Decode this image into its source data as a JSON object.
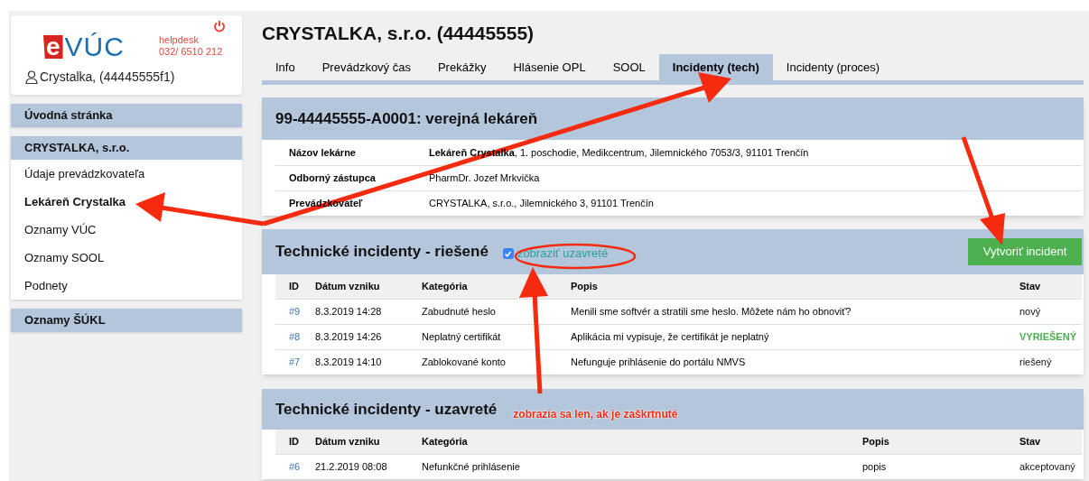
{
  "sidebar": {
    "logo": {
      "mark": "e",
      "text": "VÚC"
    },
    "helpdesk": [
      "helpdesk",
      "032/ 6510 212"
    ],
    "user": "Crystalka, (44445555f1)",
    "groups": [
      {
        "title": "Úvodná stránka"
      },
      {
        "title": "CRYSTALKA, s.r.o.",
        "items": [
          {
            "label": "Údaje prevádzkovateľa",
            "selected": false
          },
          {
            "label": "Lekáreň Crystalka",
            "selected": true
          },
          {
            "label": "Oznamy VÚC",
            "selected": false
          },
          {
            "label": "Oznamy SOOL",
            "selected": false
          },
          {
            "label": "Podnety",
            "selected": false
          }
        ]
      },
      {
        "title": "Oznamy ŠÚKL"
      }
    ]
  },
  "main": {
    "title": "CRYSTALKA, s.r.o. (44445555)",
    "tabs": [
      {
        "label": "Info",
        "selected": false
      },
      {
        "label": "Prevádzkový čas",
        "selected": false
      },
      {
        "label": "Prekážky",
        "selected": false
      },
      {
        "label": "Hlásenie OPL",
        "selected": false
      },
      {
        "label": "SOOL",
        "selected": false
      },
      {
        "label": "Incidenty (tech)",
        "selected": true
      },
      {
        "label": "Incidenty (proces)",
        "selected": false
      }
    ],
    "pharmacy": {
      "title": "99-44445555-A0001: verejná lekáreň",
      "rows": [
        {
          "label": "Názov lekárne",
          "value": "**Lekáreň Crystalka**, 1. poschodie, Medikcentrum, Jilemnického 7053/3, 91101 Trenčín"
        },
        {
          "label": "Odborný zástupca",
          "value": "PharmDr. Jozef Mrkvička"
        },
        {
          "label": "Prevádzkovateľ",
          "value": "CRYSTALKA, s.r.o., Jilemnického 3, 91101 Trenčín"
        }
      ]
    },
    "resolved": {
      "title": "Technické incidenty - riešené",
      "checkbox": {
        "label": "zobraziť uzavreté",
        "checked": true
      },
      "button": "Vytvoriť incident",
      "columns": [
        "ID",
        "Dátum vzniku",
        "Kategória",
        "Popis",
        "Stav"
      ],
      "rows": [
        {
          "id": "#9",
          "date": "8.3.2019 14:28",
          "category": "Zabudnuté heslo",
          "description": "Menili sme softvér a stratili sme heslo. Môžete nám ho obnoviť?",
          "status": "nový",
          "highlighted": false
        },
        {
          "id": "#8",
          "date": "8.3.2019 14:26",
          "category": "Neplatný certifikát",
          "description": "Aplikácia mi vypisuje, že certifikát je neplatný",
          "status": "VYRIEŠENÝ",
          "highlighted": true
        },
        {
          "id": "#7",
          "date": "8.3.2019 14:10",
          "category": "Zablokované konto",
          "description": "Nefunguje prihlásenie do portálu NMVS",
          "status": "riešený",
          "highlighted": false
        }
      ]
    },
    "closed": {
      "title": "Technické incidenty - uzavreté",
      "annotation": "zobrazia sa len, ak je zaškrtnuté",
      "columns": [
        "ID",
        "Dátum vzniku",
        "Kategória",
        "Popis",
        "Stav"
      ],
      "rows": [
        {
          "id": "#6",
          "date": "21.2.2019 08:08",
          "category": "Nefunkčné prihlásenie",
          "description": "popis",
          "status": "akceptovaný",
          "highlighted": false
        }
      ]
    }
  }
}
